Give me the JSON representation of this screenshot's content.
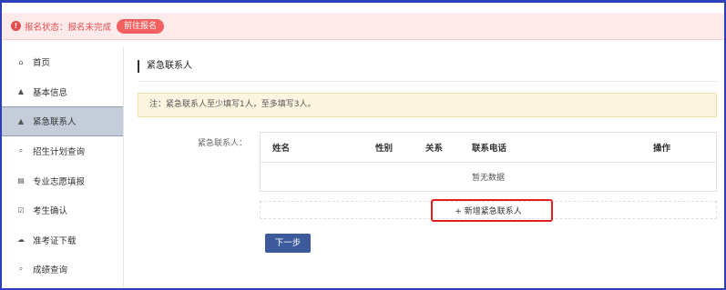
{
  "alert": {
    "icon": "exclamation-circle-icon",
    "text": "报名状态：报名未完成",
    "button_label": "前往报名"
  },
  "sidebar": {
    "items": [
      {
        "label": "首页",
        "icon": "home-icon",
        "glyph": "⌂"
      },
      {
        "label": "基本信息",
        "icon": "user-icon",
        "glyph": "▲"
      },
      {
        "label": "紧急联系人",
        "icon": "user-icon",
        "glyph": "▲",
        "active": true
      },
      {
        "label": "招生计划查询",
        "icon": "search-icon",
        "glyph": "⌕"
      },
      {
        "label": "专业志愿填报",
        "icon": "document-icon",
        "glyph": "▤"
      },
      {
        "label": "考生确认",
        "icon": "checkbox-icon",
        "glyph": "☑"
      },
      {
        "label": "准考证下载",
        "icon": "cloud-download-icon",
        "glyph": "☁"
      },
      {
        "label": "成绩查询",
        "icon": "search-icon",
        "glyph": "⌕"
      }
    ]
  },
  "main": {
    "title": "紧急联系人",
    "note": "注：紧急联系人至少填写1人，至多填写3人。",
    "form_label": "紧急联系人：",
    "table": {
      "columns": [
        "姓名",
        "性别",
        "关系",
        "联系电话",
        "操作"
      ],
      "empty_text": "暂无数据"
    },
    "add_button_label": "+ 新增紧急联系人",
    "next_button_label": "下一步"
  },
  "colors": {
    "alert_bg": "#fdeaea",
    "alert_text": "#e64a4a",
    "alert_button": "#f36060",
    "active_nav": "#c4cdd9",
    "primary_button": "#3d5a9c",
    "highlight_box": "#e02020",
    "note_bg": "#fdf5e0",
    "frame": "#2a3fb8"
  }
}
